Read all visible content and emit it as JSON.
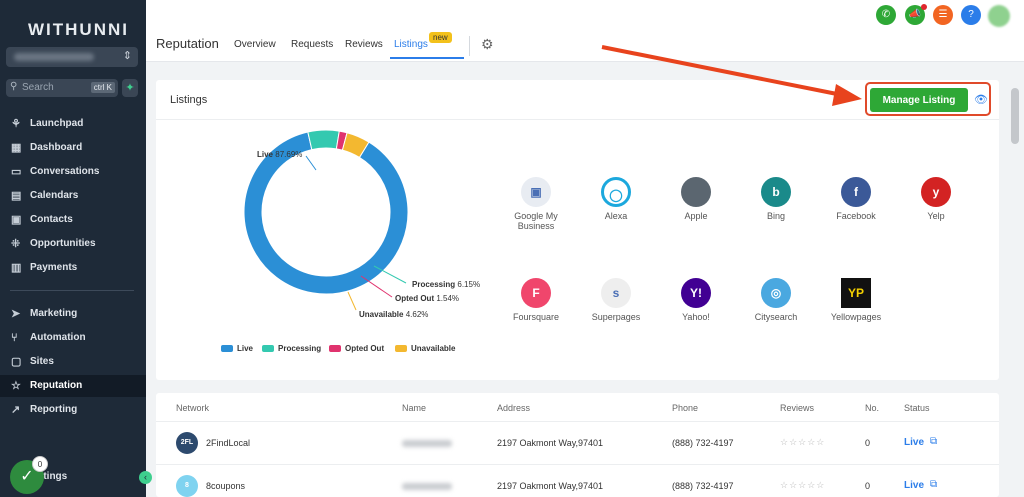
{
  "sidebar": {
    "brand": "WITHUNNI",
    "search_placeholder": "Search",
    "search_shortcut": "ctrl K",
    "items_top": [
      {
        "label": "Launchpad",
        "icon": "rocket-icon"
      },
      {
        "label": "Dashboard",
        "icon": "grid-icon"
      },
      {
        "label": "Conversations",
        "icon": "chat-icon"
      },
      {
        "label": "Calendars",
        "icon": "calendar-icon"
      },
      {
        "label": "Contacts",
        "icon": "contacts-icon"
      },
      {
        "label": "Opportunities",
        "icon": "funnel-icon"
      },
      {
        "label": "Payments",
        "icon": "receipt-icon"
      }
    ],
    "items_bottom": [
      {
        "label": "Marketing",
        "icon": "send-icon"
      },
      {
        "label": "Automation",
        "icon": "branch-icon"
      },
      {
        "label": "Sites",
        "icon": "globe-icon"
      },
      {
        "label": "Reputation",
        "icon": "star-icon",
        "active": true
      },
      {
        "label": "Reporting",
        "icon": "chart-icon"
      }
    ],
    "settings_label": "ttings",
    "notification_count": "0"
  },
  "header": {
    "title": "Reputation",
    "tabs": [
      "Overview",
      "Requests",
      "Reviews",
      "Listings"
    ],
    "active_tab": "Listings",
    "new_badge": "new",
    "top_icons": [
      {
        "name": "phone-icon",
        "color": "#2ea836"
      },
      {
        "name": "megaphone-icon",
        "color": "#2ea836"
      },
      {
        "name": "list-icon",
        "color": "#f26522"
      },
      {
        "name": "help-icon",
        "color": "#2b7de9"
      }
    ]
  },
  "listings": {
    "title": "Listings",
    "manage_button": "Manage Listing",
    "chart_data": {
      "type": "pie",
      "categories": [
        "Live",
        "Processing",
        "Opted Out",
        "Unavailable"
      ],
      "values": [
        87.69,
        6.15,
        1.54,
        4.62
      ],
      "colors": [
        "#2b8fd6",
        "#34c9b0",
        "#e0336e",
        "#f3b830"
      ],
      "value_labels": [
        "87.69%",
        "6.15%",
        "1.54%",
        "4.62%"
      ],
      "legend_position": "bottom"
    },
    "platforms": [
      {
        "name": "Google My Business",
        "icon": "google-my-business-icon",
        "color": "#e8ecf2",
        "glyph": "▣"
      },
      {
        "name": "Alexa",
        "icon": "alexa-icon",
        "color": "#ffffff",
        "glyph": "◯"
      },
      {
        "name": "Apple",
        "icon": "apple-icon",
        "color": "#5b6670",
        "glyph": ""
      },
      {
        "name": "Bing",
        "icon": "bing-icon",
        "color": "#1a8a8a",
        "glyph": "b"
      },
      {
        "name": "Facebook",
        "icon": "facebook-icon",
        "color": "#3b5998",
        "glyph": "f"
      },
      {
        "name": "Yelp",
        "icon": "yelp-icon",
        "color": "#d32323",
        "glyph": "y"
      },
      {
        "name": "Foursquare",
        "icon": "foursquare-icon",
        "color": "#f0466c",
        "glyph": "F"
      },
      {
        "name": "Superpages",
        "icon": "superpages-icon",
        "color": "#eeeeee",
        "glyph": "s"
      },
      {
        "name": "Yahoo!",
        "icon": "yahoo-icon",
        "color": "#410093",
        "glyph": "Y!"
      },
      {
        "name": "Citysearch",
        "icon": "citysearch-icon",
        "color": "#4aa8e0",
        "glyph": "◎"
      },
      {
        "name": "Yellowpages",
        "icon": "yellowpages-icon",
        "color": "#111111",
        "glyph": "YP"
      }
    ]
  },
  "table": {
    "headers": [
      "Network",
      "Name",
      "Address",
      "Phone",
      "Reviews",
      "No.",
      "Status"
    ],
    "rows": [
      {
        "badge": "2FL",
        "network": "2FindLocal",
        "address": "2197 Oakmont Way,97401",
        "phone": "(888) 732-4197",
        "reviews": "☆☆☆☆☆",
        "count": "0",
        "status": "Live",
        "badge_color": "#2d4a6e"
      },
      {
        "badge": "8",
        "network": "8coupons",
        "address": "2197 Oakmont Way,97401",
        "phone": "(888) 732-4197",
        "reviews": "☆☆☆☆☆",
        "count": "0",
        "status": "Live",
        "badge_color": "#7fd3f0"
      }
    ]
  }
}
